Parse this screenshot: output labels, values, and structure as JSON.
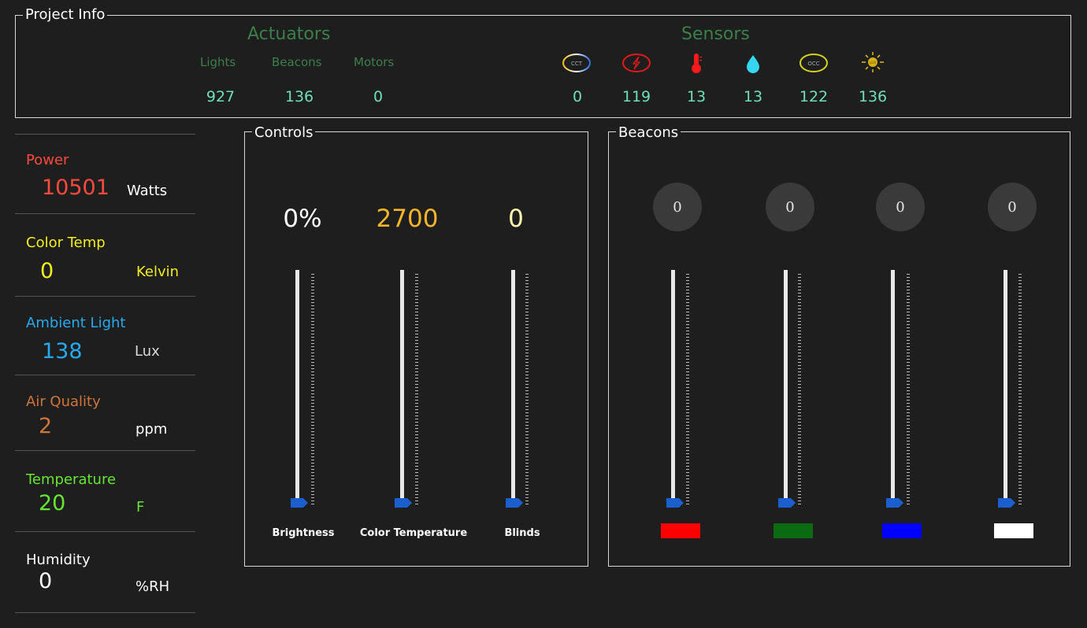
{
  "project_info": {
    "legend": "Project Info",
    "actuators": {
      "title": "Actuators",
      "items": [
        {
          "label": "Lights",
          "value": "927"
        },
        {
          "label": "Beacons",
          "value": "136"
        },
        {
          "label": "Motors",
          "value": "0"
        }
      ]
    },
    "sensors": {
      "title": "Sensors",
      "items": [
        {
          "icon": "cct-sensor-icon",
          "icon_text": "CCT",
          "value": "0"
        },
        {
          "icon": "power-sensor-icon",
          "value": "119"
        },
        {
          "icon": "thermometer-icon",
          "value": "13"
        },
        {
          "icon": "humidity-drop-icon",
          "value": "13"
        },
        {
          "icon": "occupancy-sensor-icon",
          "icon_text": "OCC",
          "value": "122"
        },
        {
          "icon": "sun-lux-icon",
          "icon_text": "LUX",
          "value": "136"
        }
      ]
    }
  },
  "metrics": [
    {
      "label": "Power",
      "value": "10501",
      "unit": "Watts",
      "color": "#ff4a3d"
    },
    {
      "label": "Color Temp",
      "value": "0",
      "unit": "Kelvin",
      "color": "#f2ee1e"
    },
    {
      "label": "Ambient Light",
      "value": "138",
      "unit": "Lux",
      "color": "#27aaf0",
      "unit_color": "#d8d8d8"
    },
    {
      "label": "Air Quality",
      "value": "2",
      "unit": "ppm",
      "color": "#d0753a",
      "unit_color": "#ffffff"
    },
    {
      "label": "Temperature",
      "value": "20",
      "unit": "F",
      "color": "#66e633"
    },
    {
      "label": "Humidity",
      "value": "0",
      "unit": "%RH",
      "color": "#ffffff"
    }
  ],
  "controls": {
    "legend": "Controls",
    "sliders": [
      {
        "value": "0%",
        "caption": "Brightness",
        "value_color": "#ffffff",
        "level": 0
      },
      {
        "value": "2700",
        "caption": "Color Temperature",
        "value_color": "#f5b52a",
        "level": 0
      },
      {
        "value": "0",
        "caption": "Blinds",
        "value_color": "#fff8b0",
        "level": 0
      }
    ]
  },
  "beacons": {
    "legend": "Beacons",
    "channels": [
      {
        "value": "0",
        "color": "#ff0000",
        "level": 0
      },
      {
        "value": "0",
        "color": "#0a6b12",
        "level": 0
      },
      {
        "value": "0",
        "color": "#0000ff",
        "level": 0
      },
      {
        "value": "0",
        "color": "#ffffff",
        "level": 0
      }
    ]
  },
  "colors": {
    "thumb": "#1b5fcf",
    "accent_green": "#3b7f4a",
    "count_green": "#6fe0b6"
  }
}
